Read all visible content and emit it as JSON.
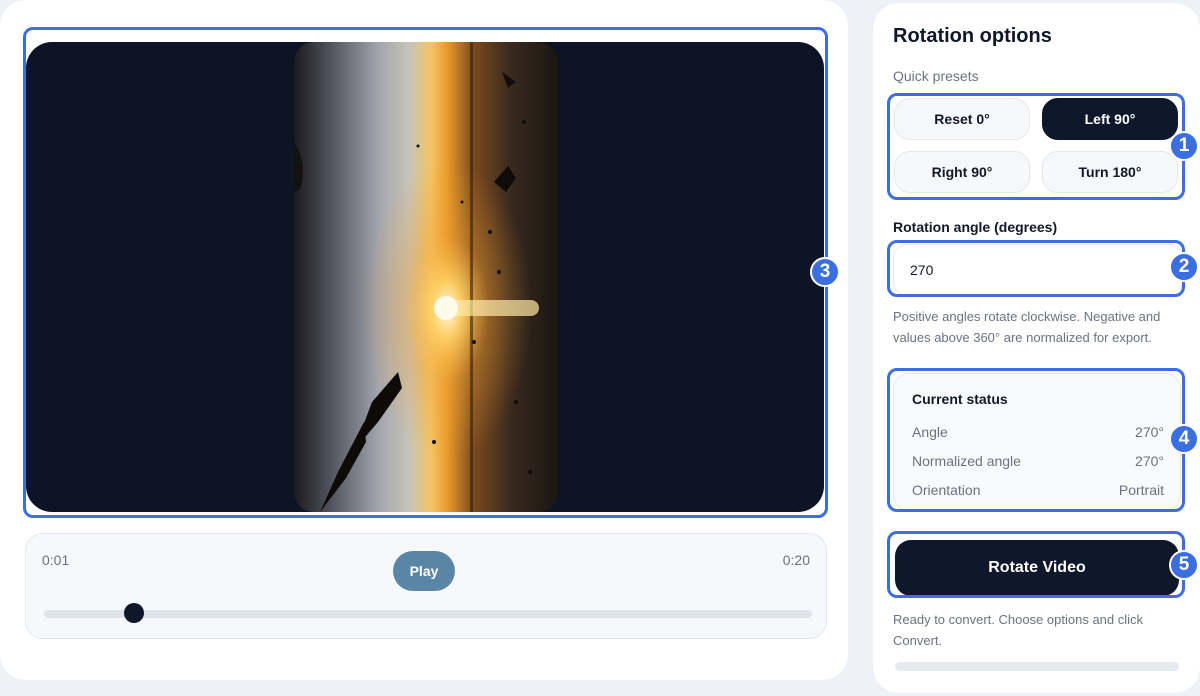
{
  "player": {
    "current_time": "0:01",
    "duration": "0:20",
    "play_label": "Play",
    "seek_position": 0.05
  },
  "panel": {
    "title": "Rotation options",
    "presets_label": "Quick presets",
    "presets": [
      {
        "label": "Reset 0°",
        "active": false
      },
      {
        "label": "Left 90°",
        "active": true
      },
      {
        "label": "Right 90°",
        "active": false
      },
      {
        "label": "Turn 180°",
        "active": false
      }
    ],
    "angle_label": "Rotation angle (degrees)",
    "angle_value": "270",
    "help_text": "Positive angles rotate clockwise. Negative and values above 360° are normalized for export.",
    "status": {
      "title": "Current status",
      "rows": [
        {
          "label": "Angle",
          "value": "270°"
        },
        {
          "label": "Normalized angle",
          "value": "270°"
        },
        {
          "label": "Orientation",
          "value": "Portrait"
        }
      ]
    },
    "rotate_label": "Rotate Video",
    "ready_text": "Ready to convert. Choose options and click Convert.",
    "progress": 0
  },
  "badges": [
    "1",
    "2",
    "3",
    "4",
    "5"
  ],
  "colors": {
    "accent": "#3b6fe0",
    "dark": "#0f172a",
    "play": "#5a86a6"
  }
}
